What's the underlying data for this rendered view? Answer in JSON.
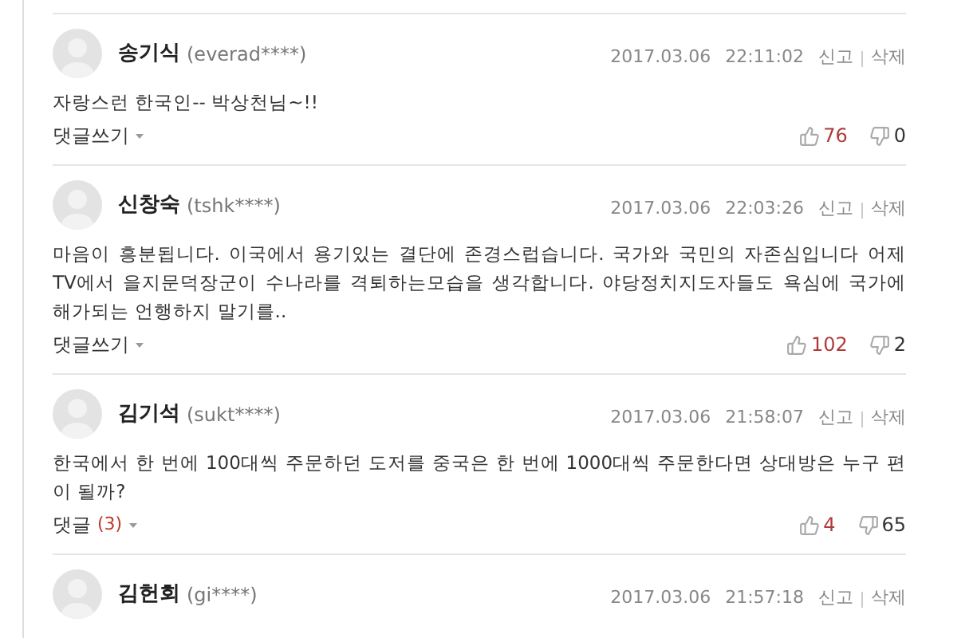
{
  "comments": [
    {
      "name": "송기식",
      "user_id": "(everad****)",
      "date": "2017.03.06",
      "time": "22:11:02",
      "report": "신고",
      "delete": "삭제",
      "body": "자랑스런 한국인-- 박상천님~!!",
      "reply_label": "댓글쓰기",
      "likes": "76",
      "dislikes": "0"
    },
    {
      "name": "신창숙",
      "user_id": "(tshk****)",
      "date": "2017.03.06",
      "time": "22:03:26",
      "report": "신고",
      "delete": "삭제",
      "body": "마음이 흥분됩니다. 이국에서 용기있는 결단에 존경스럽습니다. 국가와 국민의 자존심입니다 어제 TV에서 을지문덕장군이 수나라를 격퇴하는모습을 생각합니다. 야당정치지도자들도 욕심에 국가에 해가되는 언행하지 말기를..",
      "reply_label": "댓글쓰기",
      "likes": "102",
      "dislikes": "2"
    },
    {
      "name": "김기석",
      "user_id": "(sukt****)",
      "date": "2017.03.06",
      "time": "21:58:07",
      "report": "신고",
      "delete": "삭제",
      "body": "한국에서 한 번에 100대씩 주문하던 도저를 중국은 한 번에 1000대씩 주문한다면 상대방은 누구 편이 될까?",
      "reply_label": "댓글",
      "reply_count": "(3)",
      "likes": "4",
      "dislikes": "65"
    },
    {
      "name": "김헌회",
      "user_id": "(gi****)",
      "date": "2017.03.06",
      "time": "21:57:18",
      "report": "신고",
      "delete": "삭제"
    }
  ]
}
